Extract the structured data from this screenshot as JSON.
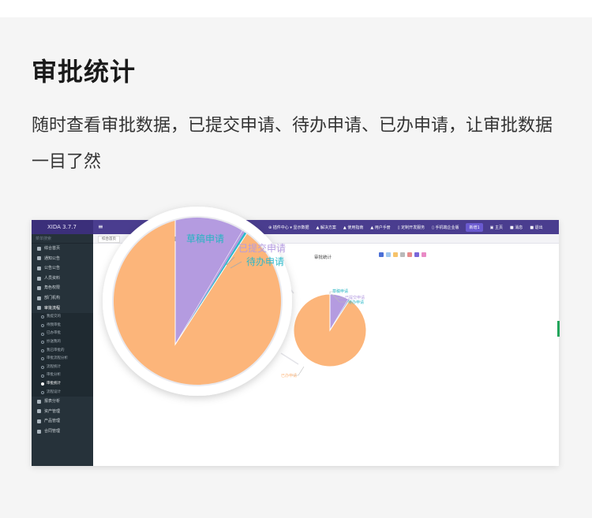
{
  "heading": "审批统计",
  "description": "随时查看审批数据，已提交申请、待办申请、已办申请，让审批数据一目了然",
  "app": {
    "title": "XIDA 3.7.7",
    "menu_icon": "≡",
    "topnav": [
      "⊕ 插件中心 ▾ 显示数据",
      "▲ 解决方案",
      "▲ 使用指南",
      "▲ 用户手册",
      "▯ 定制开发服务",
      "▯ 手机端企业版",
      "新增1",
      "▣ 主页",
      "■ 消息",
      "■ 退出"
    ],
    "sidebar_search": "菜单搜索",
    "sidebar_items": [
      "综合首页",
      "通知公告",
      "公告公告",
      "人员资料",
      "角色权限",
      "部门机构",
      "审批流程"
    ],
    "sidebar_subitems": [
      "我提交的",
      "待我审批",
      "已办审批",
      "抄送我的",
      "我已审批的",
      "审批流程分析",
      "流程统计",
      "审批分析",
      "审批统计",
      "流程设计"
    ],
    "sidebar_active": "审批统计",
    "sidebar_more": [
      "报表分析",
      "资产管理",
      "产品管理",
      "合同管理"
    ],
    "tab_label": "综合首页",
    "panel_title": "审批统计",
    "colors": {
      "topbar": "#4a3d8f",
      "sidebar": "#26323a",
      "accent": "#7a66d9"
    }
  },
  "chart_data": {
    "type": "pie",
    "title": "",
    "series": [
      {
        "label": "草稿申请",
        "value": 8.5,
        "color": "#b49be0",
        "label_color": "#25b4c2"
      },
      {
        "label": "已提交申请",
        "value": 0.3,
        "color": "#b49be0",
        "label_color": "#b49be0"
      },
      {
        "label": "待办申请",
        "value": 0.3,
        "color": "#2db8c9",
        "label_color": "#2db8c9"
      },
      {
        "label": "已办申请",
        "value": 90.9,
        "color": "#fcb57a",
        "label_color": "#fcb57a"
      }
    ]
  }
}
